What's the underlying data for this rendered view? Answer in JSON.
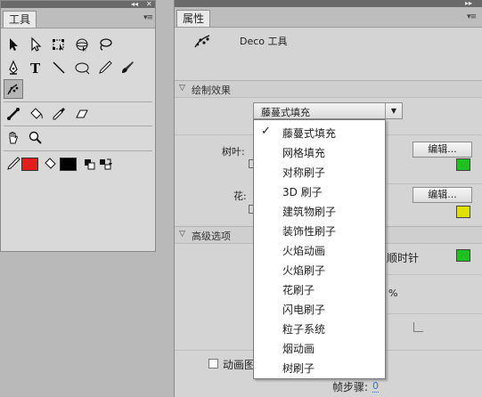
{
  "tools_panel": {
    "collapse": "◂◂",
    "close": "✕",
    "tab": "工具",
    "menu": "▾≡"
  },
  "properties_panel": {
    "collapse": "▸▸",
    "tab": "属性",
    "menu": "▾≡",
    "tool_name": "Deco 工具",
    "section_effect": "绘制效果",
    "effect_selected": "藤蔓式填充",
    "leaf_label": "树叶:",
    "flower_label": "花:",
    "edit_button": "编辑...",
    "section_advanced": "高级选项",
    "counterclockwise_suffix": "顺时针",
    "percent": "%",
    "animate_label": "动画图",
    "frame_step_label": "帧步骤:",
    "frame_step_value": "0"
  },
  "colors": {
    "stroke": "#e41c1c",
    "fill": "#000000",
    "leaf_swatch": "#20c020",
    "flower_swatch": "#e0e000",
    "advanced_swatch": "#20c020",
    "link_blue": "#3b6fd1"
  },
  "dropdown": {
    "selected_index": 0,
    "options": [
      "藤蔓式填充",
      "网格填充",
      "对称刷子",
      "3D 刷子",
      "建筑物刷子",
      "装饰性刷子",
      "火焰动画",
      "火焰刷子",
      "花刷子",
      "闪电刷子",
      "粒子系统",
      "烟动画",
      "树刷子"
    ]
  }
}
